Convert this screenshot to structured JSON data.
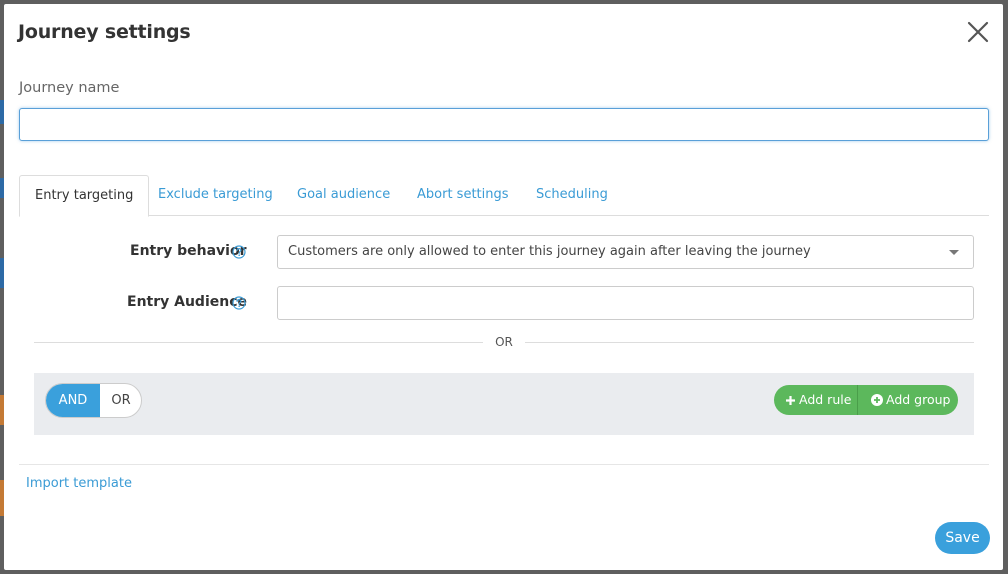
{
  "modal": {
    "title": "Journey settings",
    "name_label": "Journey name",
    "name_value": "",
    "name_placeholder": ""
  },
  "tabs": [
    {
      "label": "Entry targeting",
      "active": true
    },
    {
      "label": "Exclude targeting",
      "active": false
    },
    {
      "label": "Goal audience",
      "active": false
    },
    {
      "label": "Abort settings",
      "active": false
    },
    {
      "label": "Scheduling",
      "active": false
    }
  ],
  "entry": {
    "behavior_label": "Entry behavior",
    "behavior_value": "Customers are only allowed to enter this journey again after leaving the journey",
    "audience_label": "Entry Audience",
    "audience_value": "",
    "or_divider": "OR"
  },
  "rules": {
    "and_label": "AND",
    "or_label": "OR",
    "selected": "AND",
    "add_rule_label": "Add rule",
    "add_group_label": "Add group"
  },
  "footer": {
    "import_label": "Import template",
    "save_label": "Save"
  },
  "colors": {
    "accent": "#3aa0dc",
    "link": "#3a9bd5",
    "success": "#5cb85c",
    "panel": "#eaecef"
  },
  "icons": {
    "close": "close-icon",
    "help": "question-circle-icon",
    "caret": "caret-down-icon",
    "plus": "plus-icon",
    "plus_circle": "plus-circle-icon"
  }
}
